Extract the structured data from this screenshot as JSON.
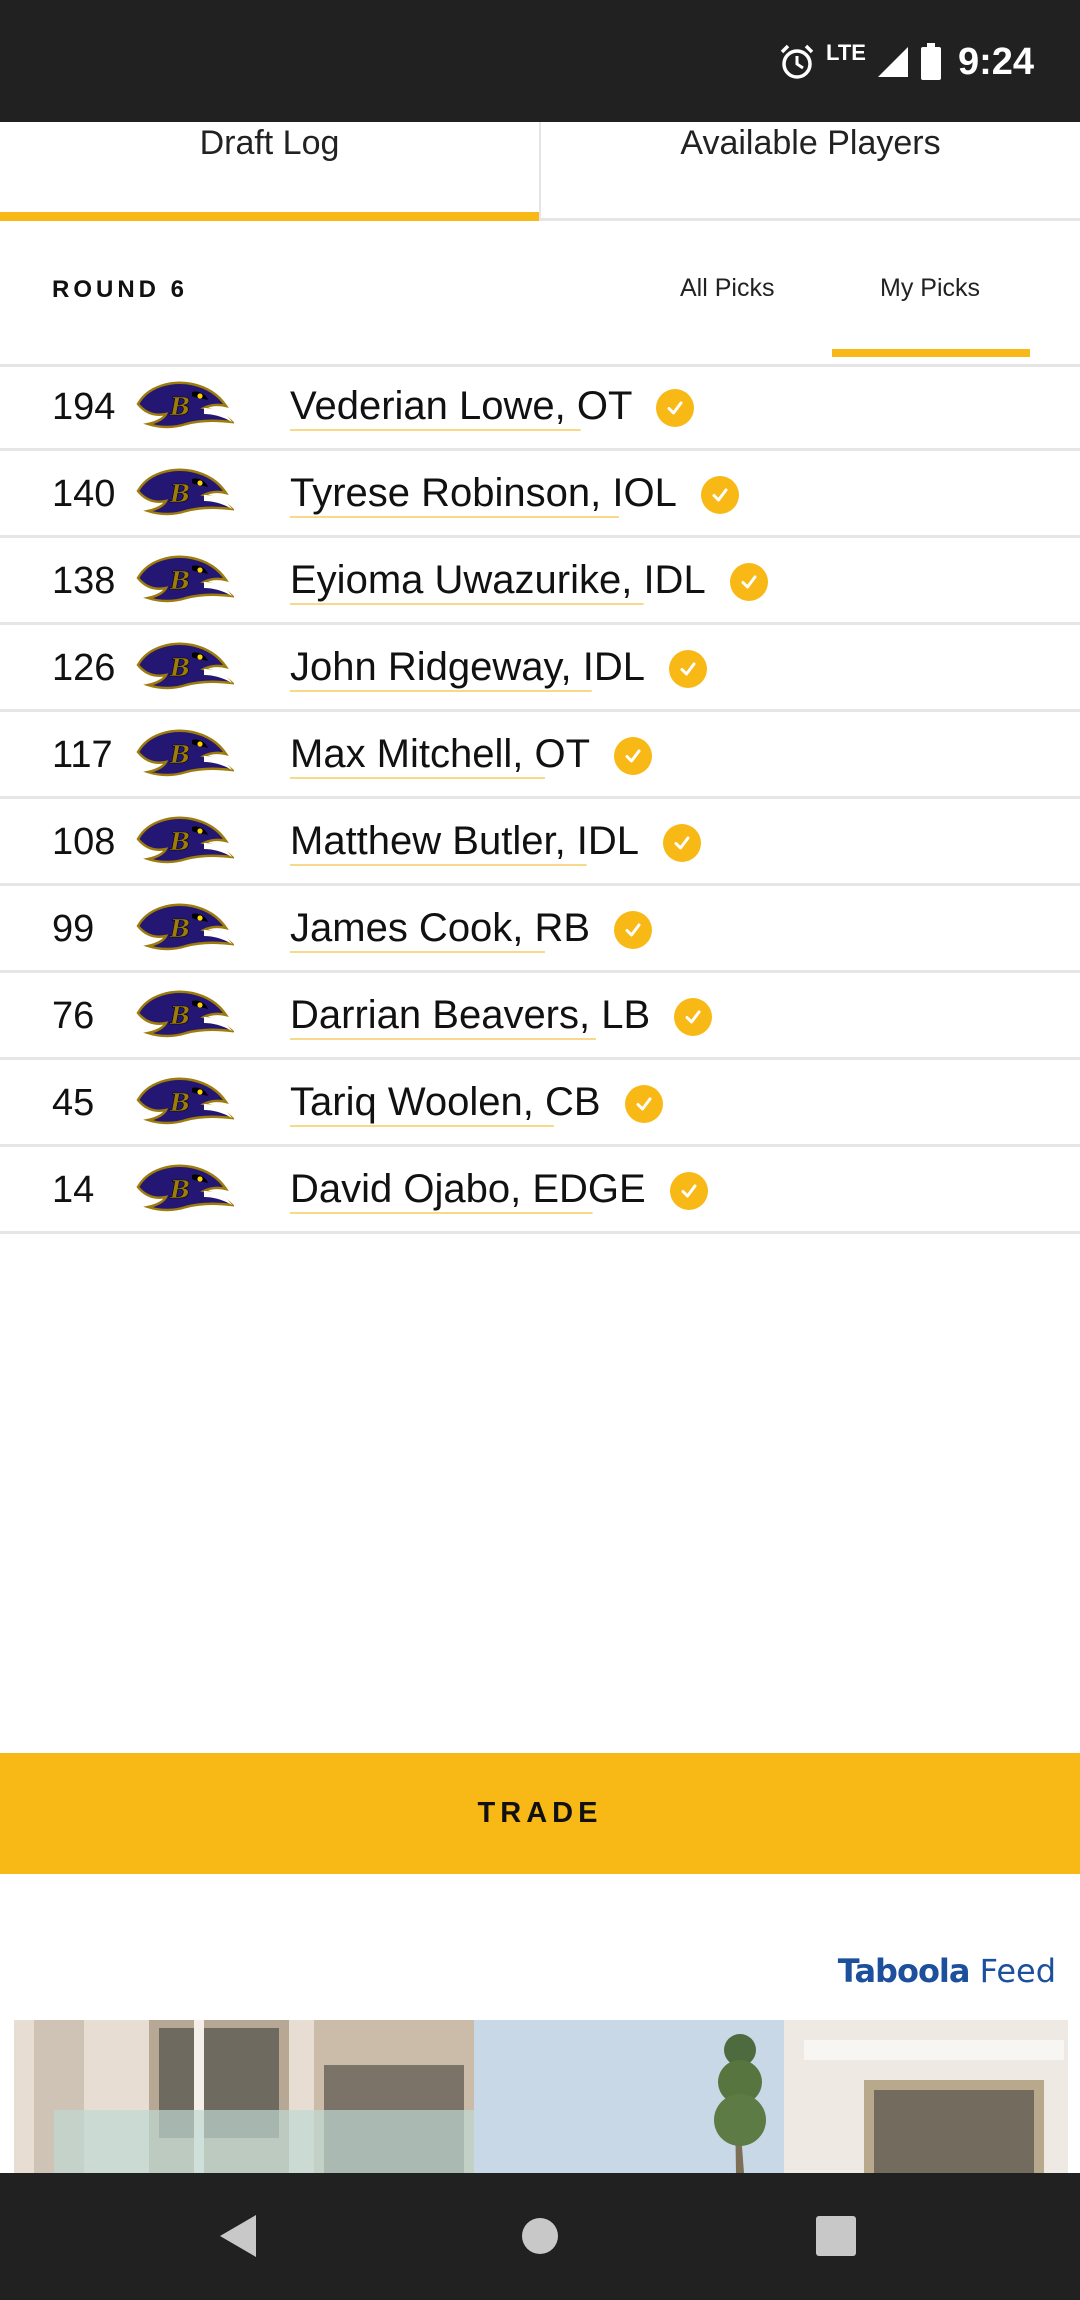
{
  "status_bar": {
    "time": "9:24",
    "network": "LTE",
    "icons": [
      "alarm-icon",
      "signal-icon",
      "battery-icon"
    ]
  },
  "top_tabs": [
    {
      "label": "Draft Log",
      "active": true
    },
    {
      "label": "Available Players",
      "active": false
    }
  ],
  "round": {
    "label": "ROUND 6",
    "sub_tabs": [
      {
        "label": "All Picks",
        "active": false
      },
      {
        "label": "My Picks",
        "active": true
      }
    ]
  },
  "picks": [
    {
      "number": "194",
      "player": "Vederian Lowe, OT",
      "team_icon": "ravens-logo"
    },
    {
      "number": "140",
      "player": "Tyrese Robinson, IOL",
      "team_icon": "ravens-logo"
    },
    {
      "number": "138",
      "player": "Eyioma Uwazurike, IDL",
      "team_icon": "ravens-logo"
    },
    {
      "number": "126",
      "player": "John Ridgeway, IDL",
      "team_icon": "ravens-logo"
    },
    {
      "number": "117",
      "player": "Max Mitchell, OT",
      "team_icon": "ravens-logo"
    },
    {
      "number": "108",
      "player": "Matthew Butler, IDL",
      "team_icon": "ravens-logo"
    },
    {
      "number": "99",
      "player": "James Cook, RB",
      "team_icon": "ravens-logo"
    },
    {
      "number": "76",
      "player": "Darrian Beavers, LB",
      "team_icon": "ravens-logo"
    },
    {
      "number": "45",
      "player": "Tariq Woolen, CB",
      "team_icon": "ravens-logo"
    },
    {
      "number": "14",
      "player": "David Ojabo, EDGE",
      "team_icon": "ravens-logo"
    }
  ],
  "trade_label": "TRADE",
  "taboola": {
    "brand": "Taboola",
    "feed": "Feed"
  },
  "colors": {
    "accent": "#f8b916",
    "bars": "#212121",
    "ravens_purple": "#241773"
  },
  "nav_icons": [
    "back-icon",
    "home-icon",
    "recents-icon"
  ]
}
